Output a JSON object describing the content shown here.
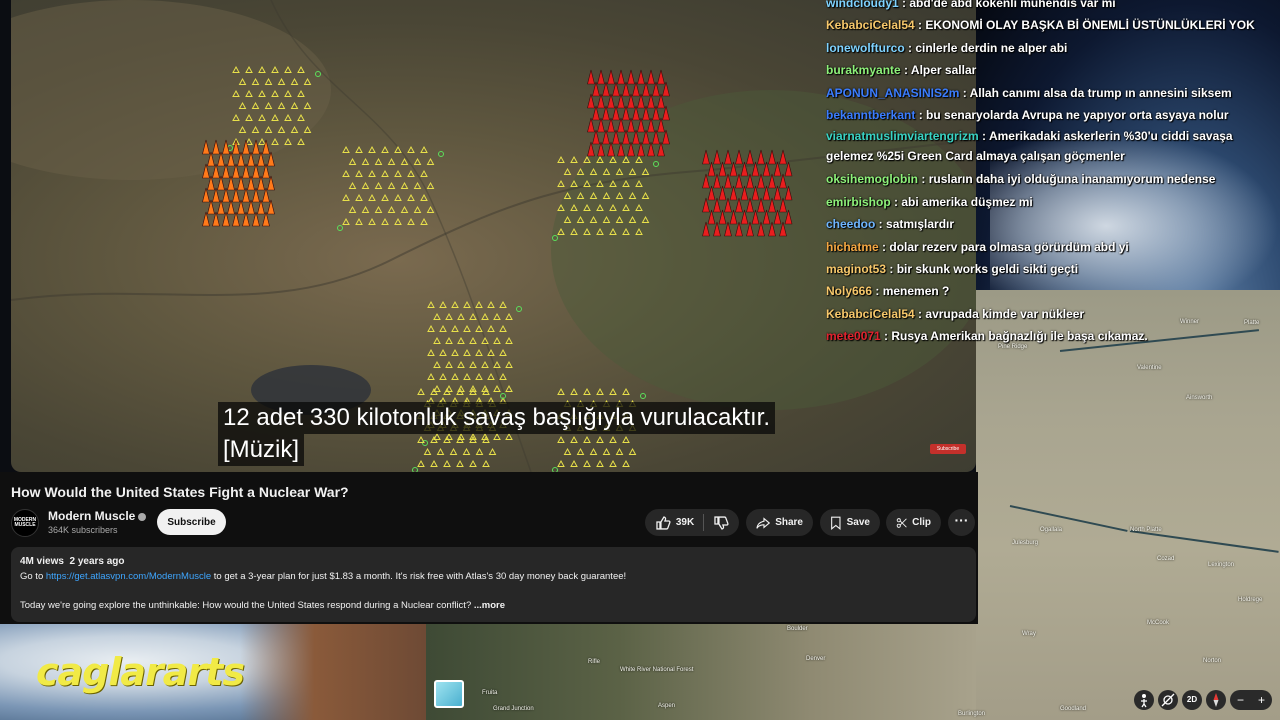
{
  "video": {
    "subtitle_line1": "12 adet 330 kilotonluk savaş başlığıyla vurulacaktır.",
    "subtitle_line2": "[Müzik]",
    "watermark": "Subscribe"
  },
  "info": {
    "title": "How Would the United States Fight a Nuclear War?",
    "channel_name": "Modern Muscle",
    "channel_avatar_text": "MODERN MUSCLE",
    "subscribers": "364K subscribers",
    "subscribe_label": "Subscribe",
    "likes": "39K",
    "share_label": "Share",
    "save_label": "Save",
    "clip_label": "Clip",
    "more_label": "···",
    "views": "4M views",
    "age": "2 years ago",
    "desc_prefix": "Go to ",
    "desc_link": "https://get.atlasvpn.com/ModernMuscle",
    "desc_suffix": " to get a 3-year plan for just $1.83 a month. It's risk free with Atlas's 30 day money back guarantee!",
    "desc_line2": "Today we're going explore the unthinkable: How would the United States respond during a Nuclear conflict?",
    "desc_more": " ...more"
  },
  "chat": [
    {
      "user": "windcloudy1",
      "color": "#7fd3ff",
      "text": "abd'de abd kökenli mühendis var mı"
    },
    {
      "user": "KebabciCelal54",
      "color": "#f7c86b",
      "text": "EKONOMİ OLAY BAŞKA Bİ ÖNEMLİ ÜSTÜNLÜKLERİ YOK"
    },
    {
      "user": "lonewolfturco",
      "color": "#7fd3ff",
      "text": "cinlerle derdin ne alper abi"
    },
    {
      "user": "burakmyante",
      "color": "#8ef27a",
      "text": "Alper sallar"
    },
    {
      "user": "APONUN_ANASINIS2m",
      "color": "#3b7dff",
      "text": "Allah canımı alsa da trump ın annesini siksem"
    },
    {
      "user": "bekanntberkant",
      "color": "#3b7dff",
      "text": "bu senaryolarda Avrupa ne yapıyor orta asyaya nolur"
    },
    {
      "user": "viarnatmuslimviartengrizm",
      "color": "#39d3c4",
      "text": "Amerikadaki askerlerin %30'u ciddi savaşa gelemez %25i Green Card almaya çalışan göçmenler",
      "wrap": true
    },
    {
      "user": "oksihemoglobin",
      "color": "#8ef27a",
      "text": "rusların daha iyi olduğuna inanamıyorum nedense"
    },
    {
      "user": "emirbishop",
      "color": "#8ef27a",
      "text": "abi amerika düşmez mi"
    },
    {
      "user": "cheedoo",
      "color": "#6fb6ff",
      "text": "satmışlardır"
    },
    {
      "user": "hichatme",
      "color": "#f4a742",
      "text": "dolar rezerv para olmasa görürdüm abd yi"
    },
    {
      "user": "maginot53",
      "color": "#f7c86b",
      "text": "bir skunk works geldi sikti geçti"
    },
    {
      "user": "Noly666",
      "color": "#f7c86b",
      "text": "menemen ?"
    },
    {
      "user": "KebabciCelal54",
      "color": "#f7c86b",
      "text": "avrupada kimde var nükleer"
    },
    {
      "user": "mete0071",
      "color": "#e0232f",
      "text": "Rusya Amerikan bağnazlığı ile başa cıkamaz."
    }
  ],
  "map_labels": [
    "Pine Ridge",
    "Winner",
    "Platte",
    "Valentine",
    "Ainsworth",
    "Ogallala",
    "North Platte",
    "Julesburg",
    "Cozad",
    "Lexington",
    "Holdrege",
    "McCook",
    "Wray",
    "Norton",
    "Denver",
    "Boulder",
    "Rifle",
    "White River National Forest",
    "Goodland",
    "Burlington",
    "Fruita",
    "Grand Junction",
    "Aspen"
  ],
  "brand_logo": "caglararts",
  "map_controls": {
    "street_view": "person-icon",
    "mode_2d": "2D",
    "compass": "compass-icon",
    "zoom_out": "−",
    "zoom_in": "+"
  }
}
